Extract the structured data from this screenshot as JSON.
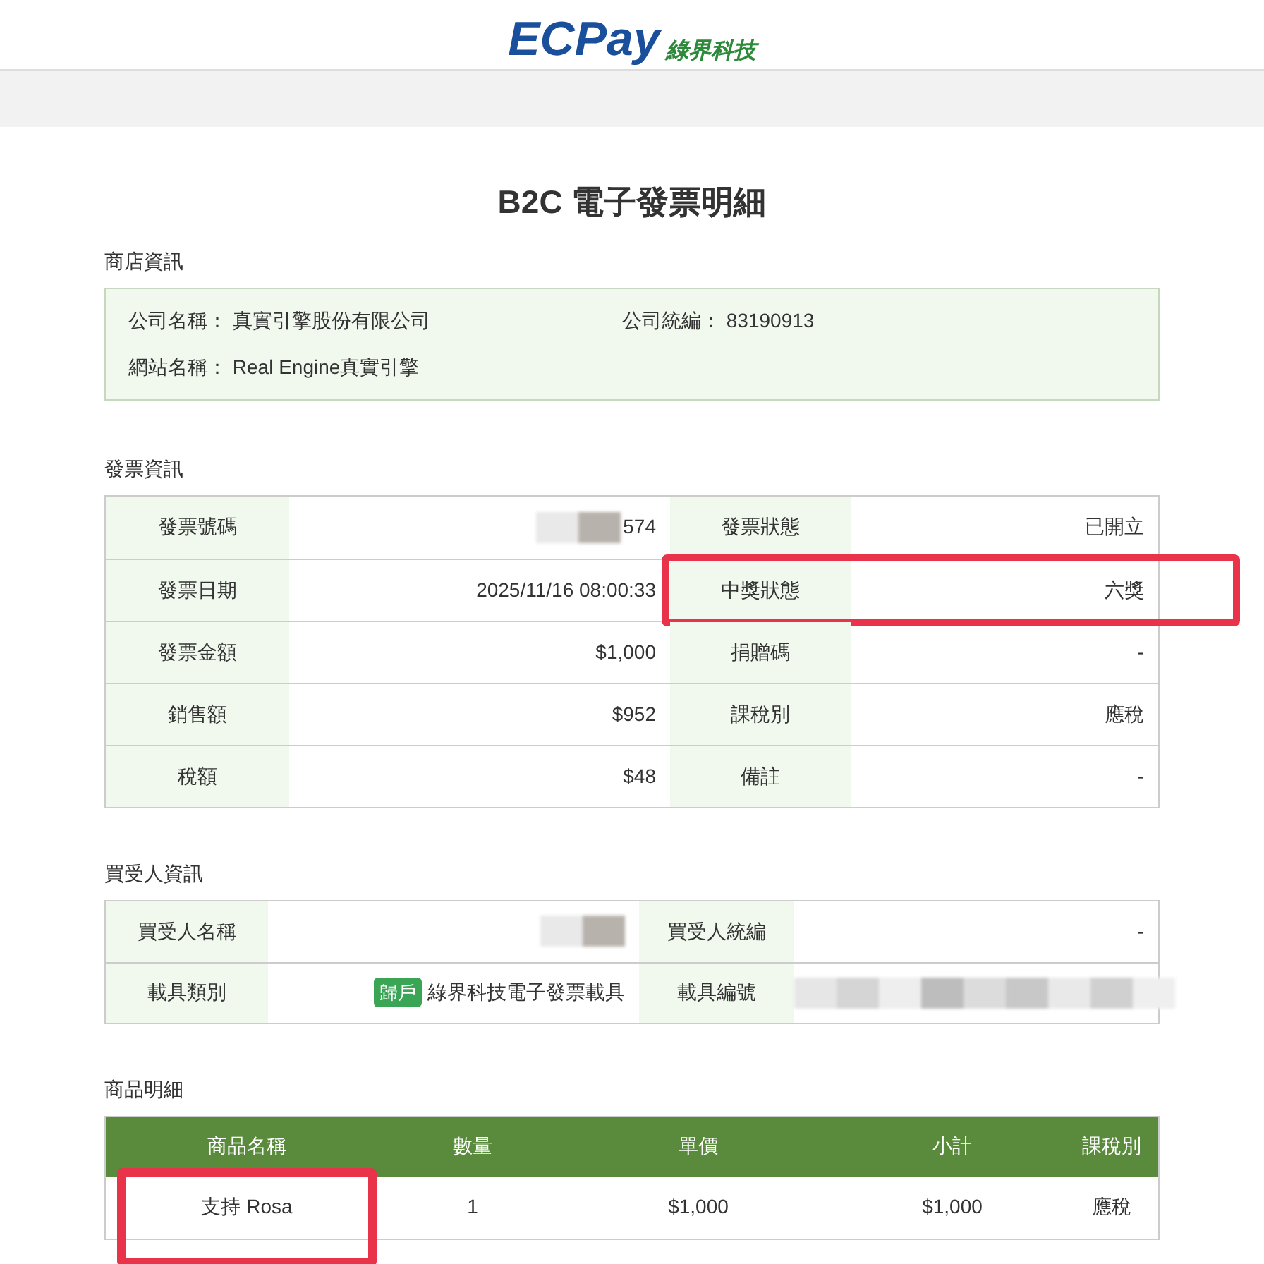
{
  "logo": {
    "wordmark": "ECPay",
    "tagline": "綠界科技"
  },
  "title": "B2C 電子發票明細",
  "store": {
    "heading": "商店資訊",
    "fields": [
      {
        "label": "公司名稱：",
        "value": "真實引擎股份有限公司"
      },
      {
        "label": "公司統編：",
        "value": "83190913"
      },
      {
        "label": "網站名稱：",
        "value": "Real Engine真實引擎"
      }
    ]
  },
  "invoice": {
    "heading": "發票資訊",
    "rows": [
      [
        {
          "label": "發票號碼",
          "value": "574",
          "blurred": true,
          "highlighted": false
        },
        {
          "label": "發票狀態",
          "value": "已開立",
          "blurred": false,
          "highlighted": false
        }
      ],
      [
        {
          "label": "發票日期",
          "value": "2025/11/16 08:00:33",
          "blurred": false,
          "highlighted": false
        },
        {
          "label": "中獎狀態",
          "value": "六獎",
          "blurred": false,
          "highlighted": true
        }
      ],
      [
        {
          "label": "發票金額",
          "value": "$1,000",
          "blurred": false,
          "highlighted": false
        },
        {
          "label": "捐贈碼",
          "value": "-",
          "blurred": false,
          "highlighted": false
        }
      ],
      [
        {
          "label": "銷售額",
          "value": "$952",
          "blurred": false,
          "highlighted": false
        },
        {
          "label": "課稅別",
          "value": "應稅",
          "blurred": false,
          "highlighted": false
        }
      ],
      [
        {
          "label": "稅額",
          "value": "$48",
          "blurred": false,
          "highlighted": false
        },
        {
          "label": "備註",
          "value": "-",
          "blurred": false,
          "highlighted": false
        }
      ]
    ]
  },
  "buyer": {
    "heading": "買受人資訊",
    "rows": [
      [
        {
          "label": "買受人名稱",
          "blurred": true
        },
        {
          "label": "買受人統編",
          "value": "-",
          "blurred": false
        }
      ],
      [
        {
          "label": "載具類別",
          "badge": "歸戶",
          "value": "綠界科技電子發票載具",
          "blurred": false
        },
        {
          "label": "載具編號",
          "blurred": true
        }
      ]
    ]
  },
  "products": {
    "heading": "商品明細",
    "columns": [
      "商品名稱",
      "數量",
      "單價",
      "小計",
      "課稅別"
    ],
    "rows": [
      {
        "cells": [
          "支持 Rosa",
          "1",
          "$1,000",
          "$1,000",
          "應稅"
        ],
        "highlighted": true
      }
    ]
  }
}
